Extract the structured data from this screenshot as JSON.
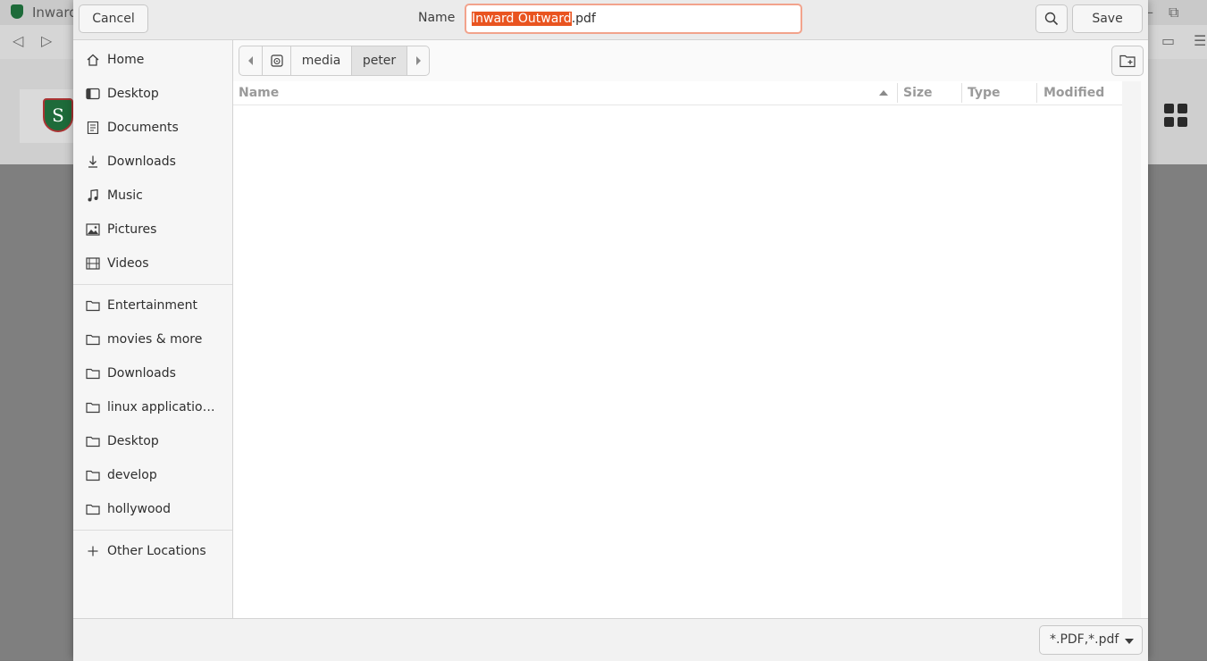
{
  "background": {
    "tab_title": "Inward",
    "logo_letter": "S"
  },
  "header": {
    "cancel_label": "Cancel",
    "name_label": "Name",
    "filename_selected": "Inward Outward",
    "filename_ext": ".pdf",
    "save_label": "Save"
  },
  "sidebar": {
    "places": [
      {
        "label": "Home",
        "icon": "home-icon"
      },
      {
        "label": "Desktop",
        "icon": "desktop-icon"
      },
      {
        "label": "Documents",
        "icon": "documents-icon"
      },
      {
        "label": "Downloads",
        "icon": "downloads-icon"
      },
      {
        "label": "Music",
        "icon": "music-icon"
      },
      {
        "label": "Pictures",
        "icon": "pictures-icon"
      },
      {
        "label": "Videos",
        "icon": "videos-icon"
      }
    ],
    "bookmarks": [
      {
        "label": "Entertainment",
        "icon": "folder-icon"
      },
      {
        "label": "movies & more",
        "icon": "folder-icon"
      },
      {
        "label": "Downloads",
        "icon": "folder-icon"
      },
      {
        "label": "linux applicatio…",
        "icon": "folder-icon"
      },
      {
        "label": "Desktop",
        "icon": "folder-icon"
      },
      {
        "label": "develop",
        "icon": "folder-icon"
      },
      {
        "label": "hollywood",
        "icon": "folder-icon"
      }
    ],
    "other_locations": "Other Locations"
  },
  "pathbar": {
    "segments": [
      "media",
      "peter"
    ],
    "active": "peter"
  },
  "filelist": {
    "columns": [
      "Name",
      "Size",
      "Type",
      "Modified"
    ],
    "sort_column": "Name",
    "rows": []
  },
  "footer": {
    "filter_label": "*.PDF,*.pdf"
  },
  "colors": {
    "accent": "#e95420",
    "focus_border": "#f2a38c"
  }
}
